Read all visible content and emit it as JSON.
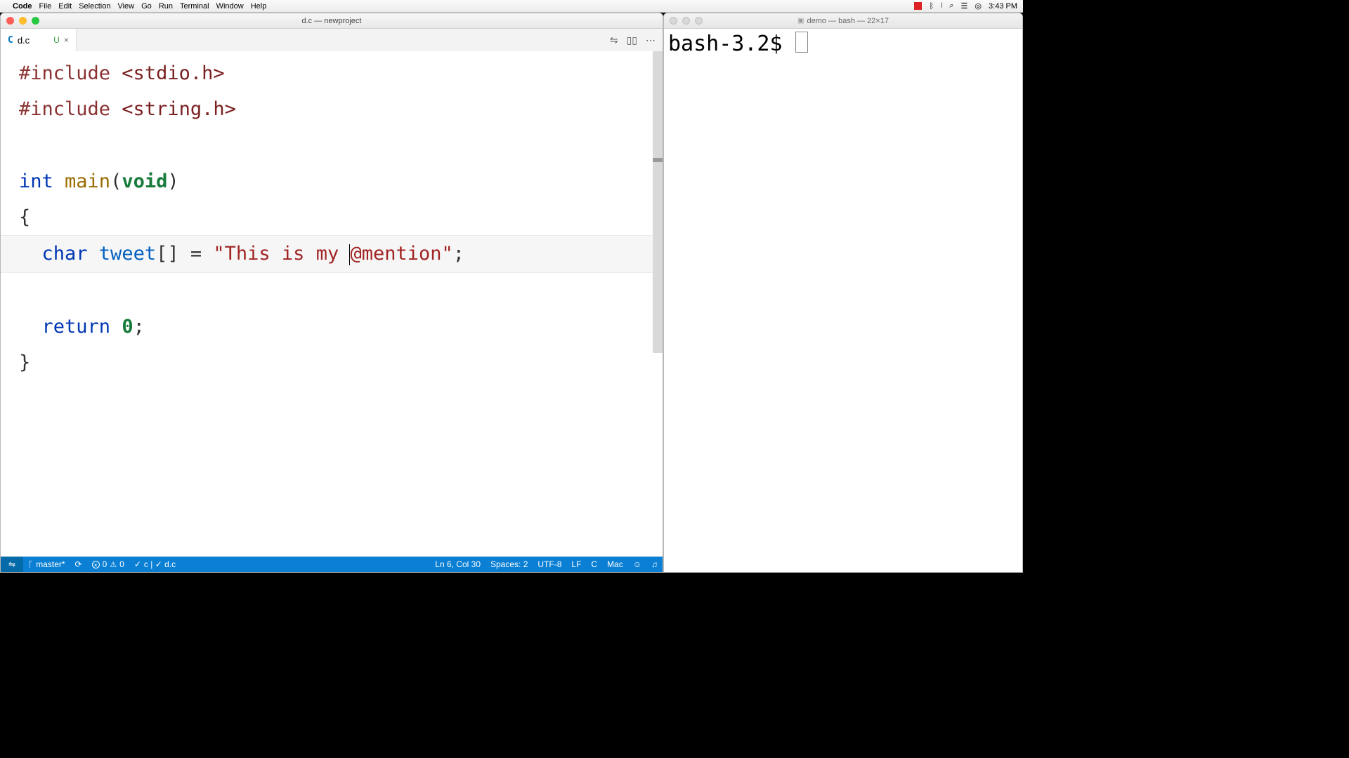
{
  "menubar": {
    "app_name": "Code",
    "items": [
      "File",
      "Edit",
      "Selection",
      "View",
      "Go",
      "Run",
      "Terminal",
      "Window",
      "Help"
    ],
    "clock": "3:43 PM"
  },
  "vscode": {
    "window_title": "d.c — newproject",
    "tab": {
      "icon_letter": "C",
      "filename": "d.c",
      "modified_marker": "U",
      "close_glyph": "×"
    },
    "code": {
      "line1_pre": "#include",
      "line1_hdr": " <stdio.h>",
      "line2_pre": "#include",
      "line2_hdr": " <string.h>",
      "line4_int": "int",
      "line4_main": " main",
      "line4_paren_open": "(",
      "line4_void": "void",
      "line4_paren_close": ")",
      "line5_brace": "{",
      "line6_indent": "  ",
      "line6_char": "char",
      "line6_var": " tweet",
      "line6_brackets": "[] ",
      "line6_eq": "= ",
      "line6_str1": "\"This is my ",
      "line6_str2": "@mention\"",
      "line6_semi": ";",
      "line8_indent": "  ",
      "line8_return": "return",
      "line8_zero": " 0",
      "line8_semi": ";",
      "line9_brace": "}"
    },
    "status": {
      "branch": "master*",
      "error_count": "0",
      "warn_count": "0",
      "lint": "c | ✓ d.c",
      "cursor": "Ln 6, Col 30",
      "spaces": "Spaces: 2",
      "encoding": "UTF-8",
      "eol": "LF",
      "lang": "C",
      "os": "Mac"
    }
  },
  "terminal": {
    "window_title": "demo — bash — 22×17",
    "prompt": "bash-3.2$"
  }
}
